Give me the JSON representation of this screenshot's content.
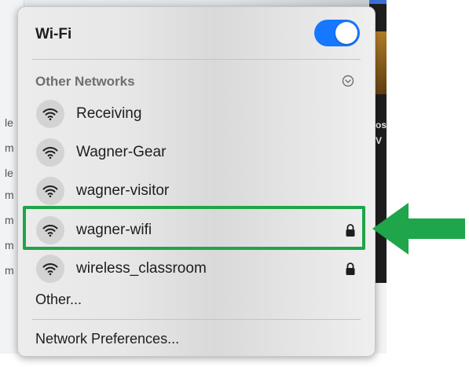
{
  "wifi": {
    "title": "Wi-Fi",
    "enabled": true
  },
  "other_networks": {
    "section_title": "Other Networks",
    "networks": [
      {
        "name": "Receiving",
        "secured": false
      },
      {
        "name": "Wagner-Gear",
        "secured": false
      },
      {
        "name": "wagner-visitor",
        "secured": false
      },
      {
        "name": "wagner-wifi",
        "secured": true,
        "highlighted": true
      },
      {
        "name": "wireless_classroom",
        "secured": true
      }
    ]
  },
  "menu": {
    "other_label": "Other...",
    "preferences_label": "Network Preferences..."
  },
  "icons": {
    "network": "wifi-icon",
    "secured": "lock-icon",
    "expand": "chevron-down-circle-icon"
  },
  "colors": {
    "toggle_on": "#1677ff",
    "annotation": "#1fa54a"
  },
  "background": {
    "left_fragments": [
      "le",
      "m",
      "le",
      "m",
      "m",
      "m",
      "m"
    ],
    "right_fragments": [
      "os",
      "V"
    ]
  }
}
